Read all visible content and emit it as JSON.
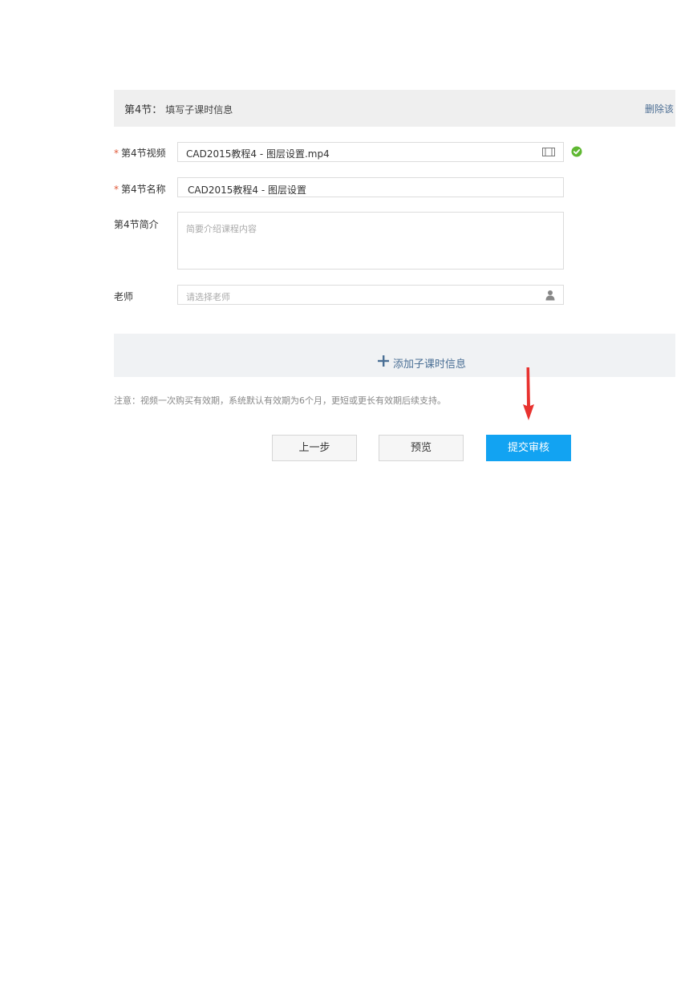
{
  "section": {
    "title": "第4节：",
    "subtitle": "填写子课时信息",
    "delete_label": "删除该"
  },
  "form": {
    "video": {
      "required_mark": "*",
      "label": "第4节视频",
      "value": "CAD2015教程4 - 图层设置.mp4"
    },
    "name": {
      "required_mark": "*",
      "label": "第4节名称",
      "value": "CAD2015教程4 - 图层设置"
    },
    "intro": {
      "label": "第4节简介",
      "placeholder": "简要介绍课程内容"
    },
    "teacher": {
      "label": "老师",
      "placeholder": "请选择老师"
    }
  },
  "add_subsection_label": "添加子课时信息",
  "notice": "注意：视频一次购买有效期，系统默认有效期为6个月，更短或更长有效期后续支持。",
  "buttons": {
    "prev": "上一步",
    "preview": "预览",
    "submit": "提交审核"
  },
  "colors": {
    "primary": "#12a3f2",
    "annotation_arrow": "#e8322f",
    "success": "#5fb832",
    "link": "#4b6d93"
  }
}
